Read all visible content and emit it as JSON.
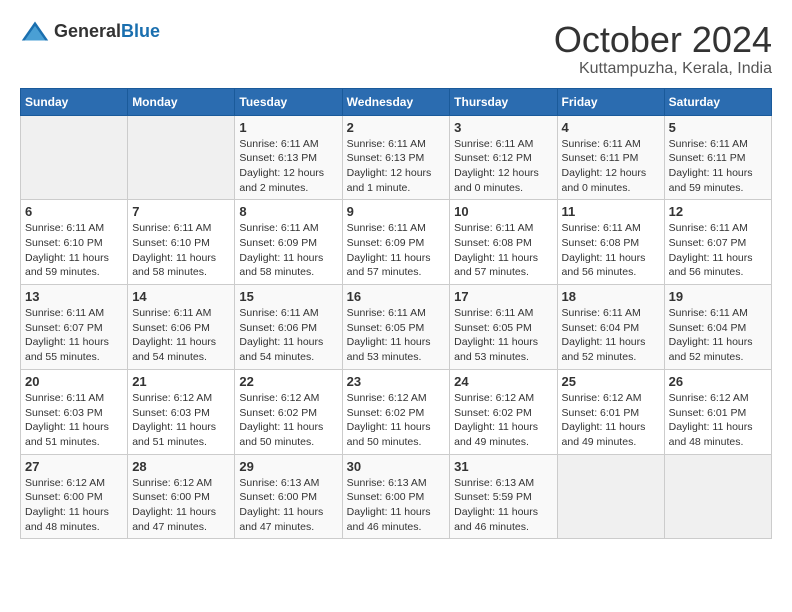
{
  "header": {
    "logo_general": "General",
    "logo_blue": "Blue",
    "title": "October 2024",
    "subtitle": "Kuttampuzha, Kerala, India"
  },
  "calendar": {
    "weekdays": [
      "Sunday",
      "Monday",
      "Tuesday",
      "Wednesday",
      "Thursday",
      "Friday",
      "Saturday"
    ],
    "weeks": [
      [
        {
          "day": "",
          "info": ""
        },
        {
          "day": "",
          "info": ""
        },
        {
          "day": "1",
          "info": "Sunrise: 6:11 AM\nSunset: 6:13 PM\nDaylight: 12 hours\nand 2 minutes."
        },
        {
          "day": "2",
          "info": "Sunrise: 6:11 AM\nSunset: 6:13 PM\nDaylight: 12 hours\nand 1 minute."
        },
        {
          "day": "3",
          "info": "Sunrise: 6:11 AM\nSunset: 6:12 PM\nDaylight: 12 hours\nand 0 minutes."
        },
        {
          "day": "4",
          "info": "Sunrise: 6:11 AM\nSunset: 6:11 PM\nDaylight: 12 hours\nand 0 minutes."
        },
        {
          "day": "5",
          "info": "Sunrise: 6:11 AM\nSunset: 6:11 PM\nDaylight: 11 hours\nand 59 minutes."
        }
      ],
      [
        {
          "day": "6",
          "info": "Sunrise: 6:11 AM\nSunset: 6:10 PM\nDaylight: 11 hours\nand 59 minutes."
        },
        {
          "day": "7",
          "info": "Sunrise: 6:11 AM\nSunset: 6:10 PM\nDaylight: 11 hours\nand 58 minutes."
        },
        {
          "day": "8",
          "info": "Sunrise: 6:11 AM\nSunset: 6:09 PM\nDaylight: 11 hours\nand 58 minutes."
        },
        {
          "day": "9",
          "info": "Sunrise: 6:11 AM\nSunset: 6:09 PM\nDaylight: 11 hours\nand 57 minutes."
        },
        {
          "day": "10",
          "info": "Sunrise: 6:11 AM\nSunset: 6:08 PM\nDaylight: 11 hours\nand 57 minutes."
        },
        {
          "day": "11",
          "info": "Sunrise: 6:11 AM\nSunset: 6:08 PM\nDaylight: 11 hours\nand 56 minutes."
        },
        {
          "day": "12",
          "info": "Sunrise: 6:11 AM\nSunset: 6:07 PM\nDaylight: 11 hours\nand 56 minutes."
        }
      ],
      [
        {
          "day": "13",
          "info": "Sunrise: 6:11 AM\nSunset: 6:07 PM\nDaylight: 11 hours\nand 55 minutes."
        },
        {
          "day": "14",
          "info": "Sunrise: 6:11 AM\nSunset: 6:06 PM\nDaylight: 11 hours\nand 54 minutes."
        },
        {
          "day": "15",
          "info": "Sunrise: 6:11 AM\nSunset: 6:06 PM\nDaylight: 11 hours\nand 54 minutes."
        },
        {
          "day": "16",
          "info": "Sunrise: 6:11 AM\nSunset: 6:05 PM\nDaylight: 11 hours\nand 53 minutes."
        },
        {
          "day": "17",
          "info": "Sunrise: 6:11 AM\nSunset: 6:05 PM\nDaylight: 11 hours\nand 53 minutes."
        },
        {
          "day": "18",
          "info": "Sunrise: 6:11 AM\nSunset: 6:04 PM\nDaylight: 11 hours\nand 52 minutes."
        },
        {
          "day": "19",
          "info": "Sunrise: 6:11 AM\nSunset: 6:04 PM\nDaylight: 11 hours\nand 52 minutes."
        }
      ],
      [
        {
          "day": "20",
          "info": "Sunrise: 6:11 AM\nSunset: 6:03 PM\nDaylight: 11 hours\nand 51 minutes."
        },
        {
          "day": "21",
          "info": "Sunrise: 6:12 AM\nSunset: 6:03 PM\nDaylight: 11 hours\nand 51 minutes."
        },
        {
          "day": "22",
          "info": "Sunrise: 6:12 AM\nSunset: 6:02 PM\nDaylight: 11 hours\nand 50 minutes."
        },
        {
          "day": "23",
          "info": "Sunrise: 6:12 AM\nSunset: 6:02 PM\nDaylight: 11 hours\nand 50 minutes."
        },
        {
          "day": "24",
          "info": "Sunrise: 6:12 AM\nSunset: 6:02 PM\nDaylight: 11 hours\nand 49 minutes."
        },
        {
          "day": "25",
          "info": "Sunrise: 6:12 AM\nSunset: 6:01 PM\nDaylight: 11 hours\nand 49 minutes."
        },
        {
          "day": "26",
          "info": "Sunrise: 6:12 AM\nSunset: 6:01 PM\nDaylight: 11 hours\nand 48 minutes."
        }
      ],
      [
        {
          "day": "27",
          "info": "Sunrise: 6:12 AM\nSunset: 6:00 PM\nDaylight: 11 hours\nand 48 minutes."
        },
        {
          "day": "28",
          "info": "Sunrise: 6:12 AM\nSunset: 6:00 PM\nDaylight: 11 hours\nand 47 minutes."
        },
        {
          "day": "29",
          "info": "Sunrise: 6:13 AM\nSunset: 6:00 PM\nDaylight: 11 hours\nand 47 minutes."
        },
        {
          "day": "30",
          "info": "Sunrise: 6:13 AM\nSunset: 6:00 PM\nDaylight: 11 hours\nand 46 minutes."
        },
        {
          "day": "31",
          "info": "Sunrise: 6:13 AM\nSunset: 5:59 PM\nDaylight: 11 hours\nand 46 minutes."
        },
        {
          "day": "",
          "info": ""
        },
        {
          "day": "",
          "info": ""
        }
      ]
    ]
  }
}
